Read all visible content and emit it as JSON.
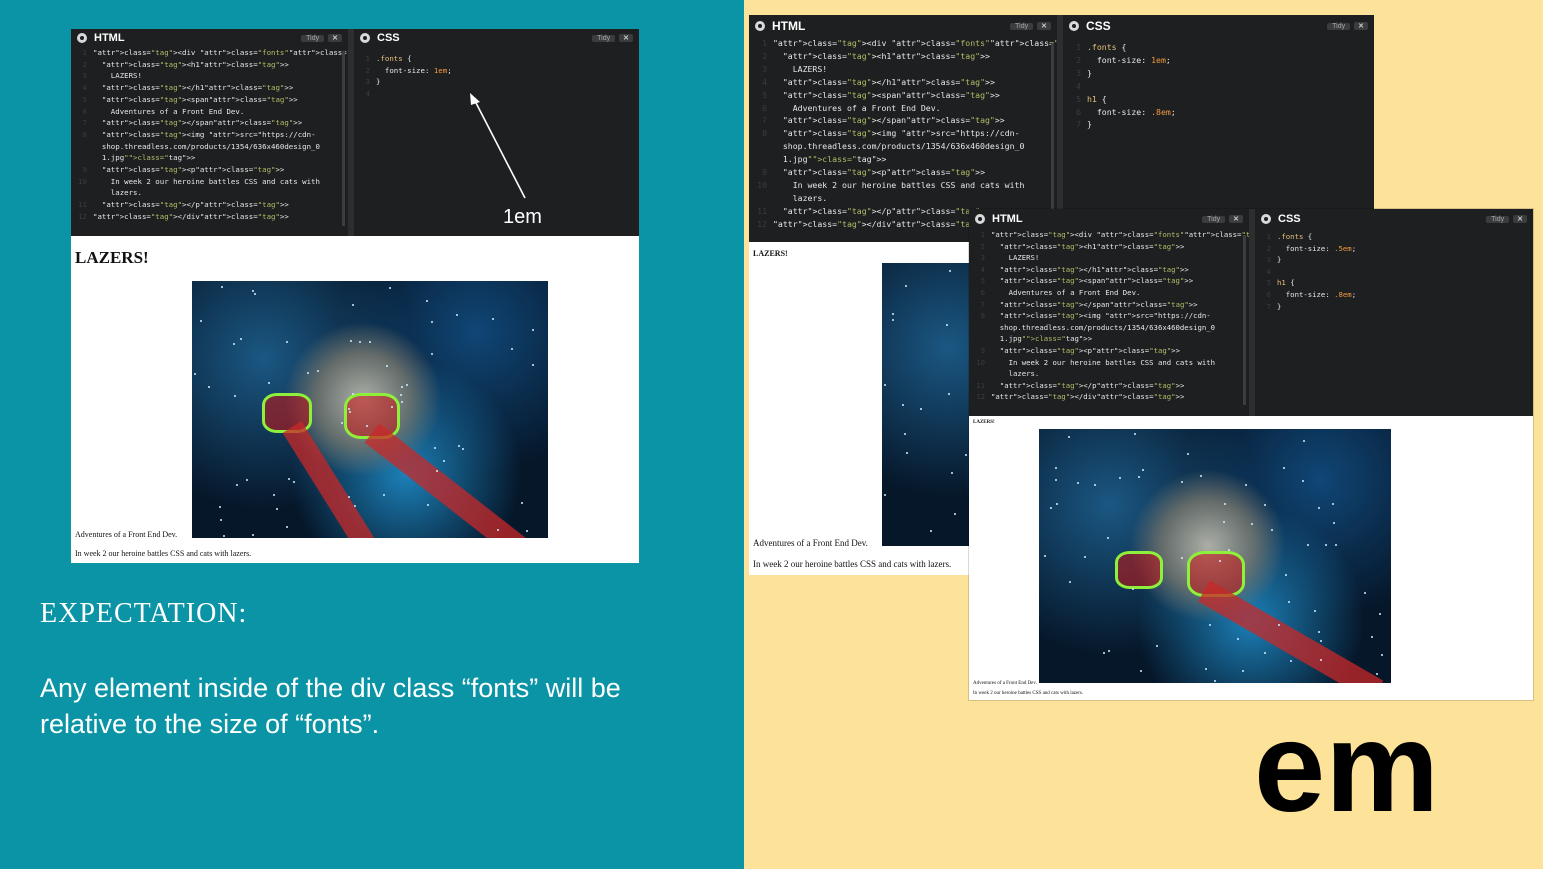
{
  "left": {
    "editor": {
      "html_title": "HTML",
      "css_title": "CSS",
      "tidy_label": "Tidy",
      "close_label": "✕",
      "html_lines": [
        {
          "n": "1",
          "t": "<div class=\"fonts\">"
        },
        {
          "n": "2",
          "t": "  <h1>"
        },
        {
          "n": "3",
          "t": "    LAZERS!"
        },
        {
          "n": "4",
          "t": "  </h1>"
        },
        {
          "n": "5",
          "t": "  <span>"
        },
        {
          "n": "6",
          "t": "    Adventures of a Front End Dev."
        },
        {
          "n": "7",
          "t": "  </span>"
        },
        {
          "n": "8",
          "t": "  <img src=\"https://cdn-"
        },
        {
          "n": "",
          "t": "  shop.threadless.com/products/1354/636x460design_0"
        },
        {
          "n": "",
          "t": "  1.jpg\">"
        },
        {
          "n": "9",
          "t": "  <p>"
        },
        {
          "n": "10",
          "t": "    In week 2 our heroine battles CSS and cats with"
        },
        {
          "n": "",
          "t": "    lazers."
        },
        {
          "n": "11",
          "t": "  </p>"
        },
        {
          "n": "12",
          "t": "</div>"
        }
      ],
      "css_lines": [
        {
          "n": "1",
          "t": ".fonts {"
        },
        {
          "n": "2",
          "t": "  font-size: 1em;"
        },
        {
          "n": "3",
          "t": "}"
        },
        {
          "n": "4",
          "t": ""
        }
      ]
    },
    "page": {
      "heading": "LAZERS!",
      "span_text": "Adventures of a Front End Dev.",
      "para_text": "In week 2 our heroine battles CSS and cats with lazers."
    },
    "arrow_label": "1em",
    "expectation_title": "EXPECTATION:",
    "expectation_text": "Any element inside of the div class “fonts” will be relative to the size of “fonts”."
  },
  "right": {
    "back_editor": {
      "html_title": "HTML",
      "css_title": "CSS",
      "tidy_label": "Tidy",
      "close_label": "✕",
      "css_lines": [
        {
          "n": "1",
          "t": ".fonts {"
        },
        {
          "n": "2",
          "t": "  font-size: 1em;"
        },
        {
          "n": "3",
          "t": "}"
        },
        {
          "n": "4",
          "t": ""
        },
        {
          "n": "5",
          "t": "h1 {"
        },
        {
          "n": "6",
          "t": "  font-size: .8em;"
        },
        {
          "n": "7",
          "t": "}"
        }
      ]
    },
    "back_page": {
      "heading": "LAZERS!",
      "span_text": "Adventures of a Front End Dev.",
      "para_text": "In week 2 our heroine battles CSS and cats with lazers."
    },
    "front_editor": {
      "html_title": "HTML",
      "css_title": "CSS",
      "tidy_label": "Tidy",
      "close_label": "✕",
      "css_lines": [
        {
          "n": "1",
          "t": ".fonts {"
        },
        {
          "n": "2",
          "t": "  font-size: .5em;"
        },
        {
          "n": "3",
          "t": "}"
        },
        {
          "n": "4",
          "t": ""
        },
        {
          "n": "5",
          "t": "h1 {"
        },
        {
          "n": "6",
          "t": "  font-size: .8em;"
        },
        {
          "n": "7",
          "t": "}"
        }
      ]
    },
    "front_page": {
      "heading": "LAZERS!",
      "span_text": "Adventures of a Front End Dev.",
      "para_text": "In week 2 our heroine battles CSS and cats with lazers."
    },
    "big_label": "em"
  },
  "colors": {
    "teal": "#0a94a6",
    "cream": "#fde29a",
    "editor_bg": "#1d1f20"
  }
}
